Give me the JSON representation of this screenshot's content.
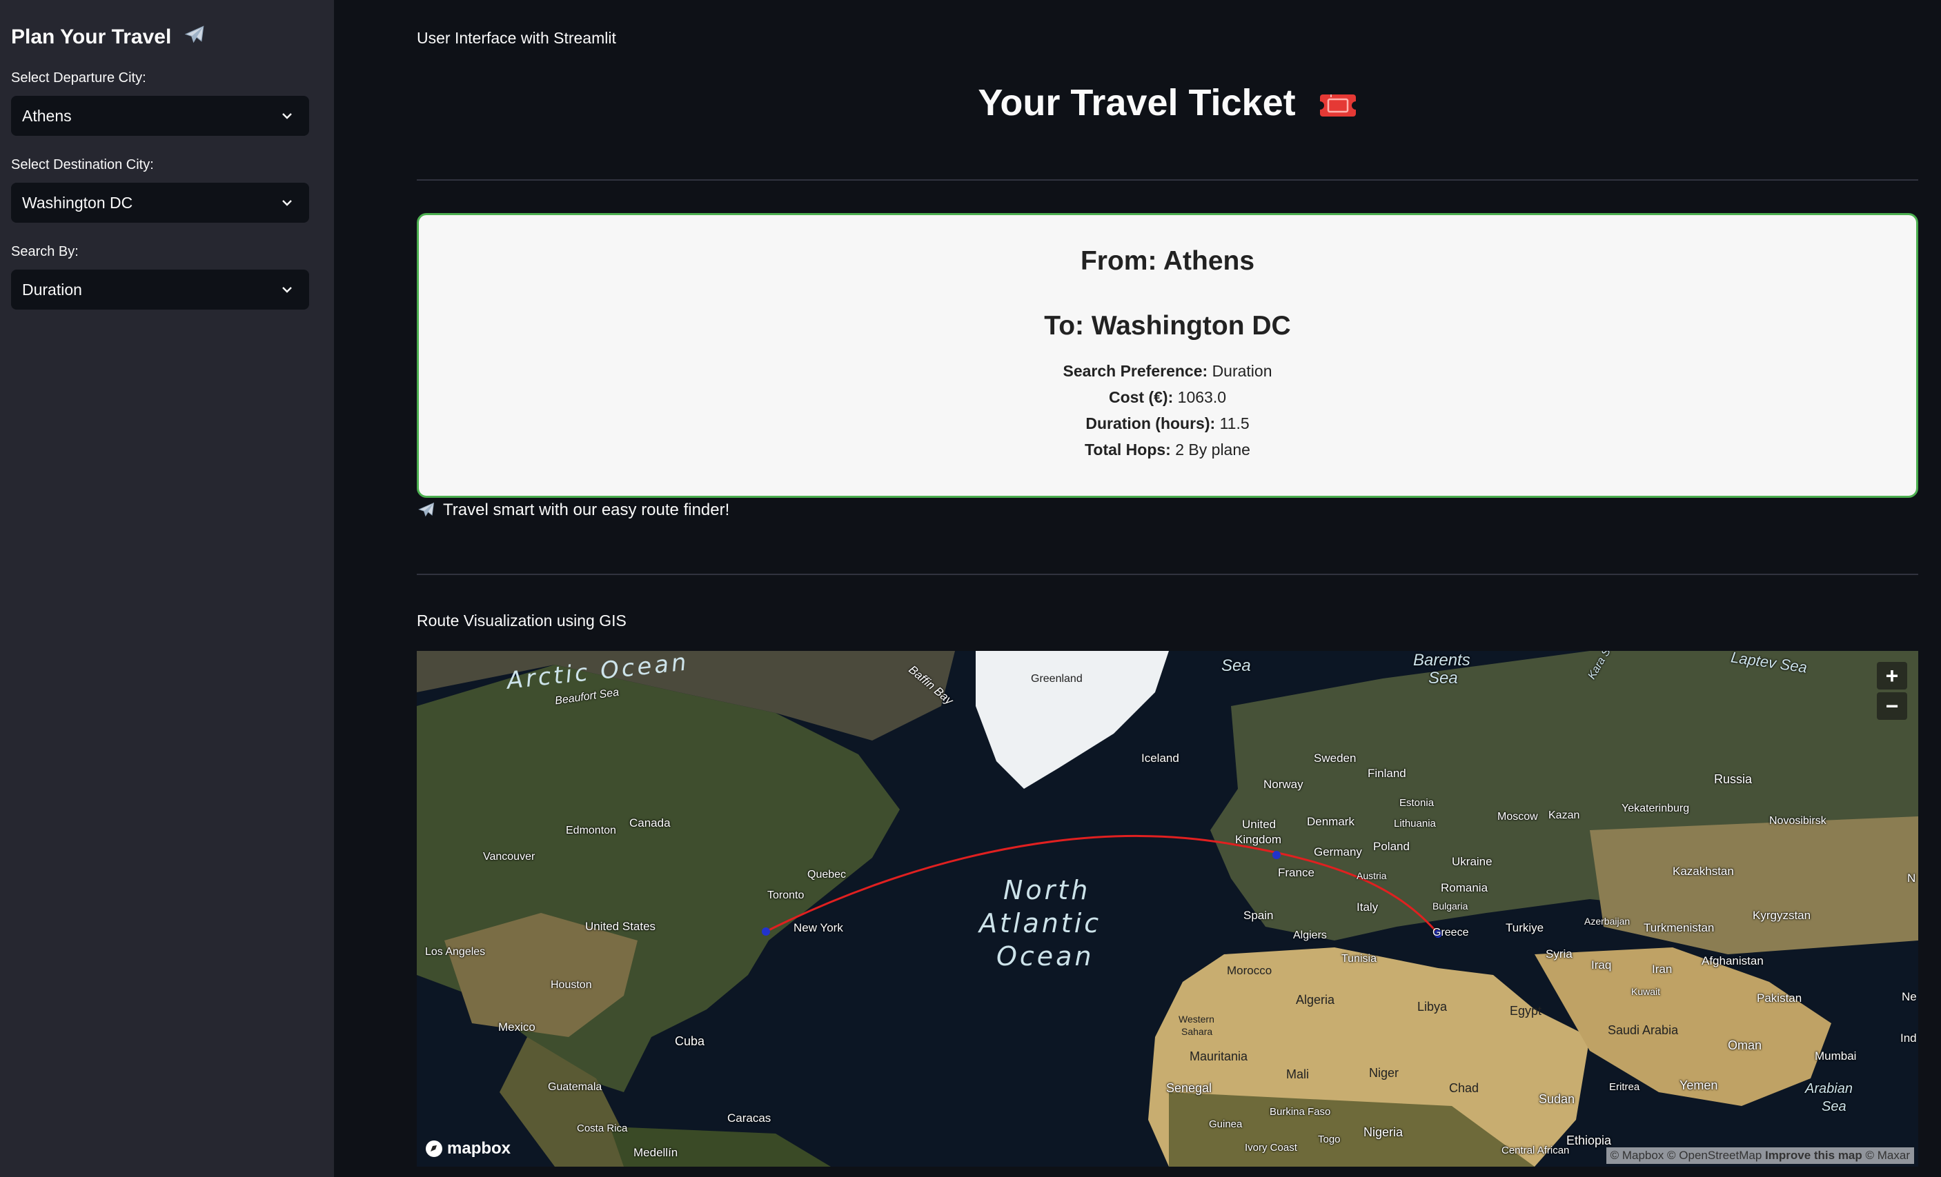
{
  "sidebar": {
    "title": "Plan Your Travel",
    "departure_label": "Select Departure City:",
    "departure_value": "Athens",
    "destination_label": "Select Destination City:",
    "destination_value": "Washington DC",
    "search_label": "Search By:",
    "search_value": "Duration"
  },
  "main": {
    "caption": "User Interface with Streamlit",
    "title": "Your Travel Ticket",
    "ticket": {
      "from": "From: Athens",
      "to": "To: Washington DC",
      "pref_label": "Search Preference:",
      "pref_value": "Duration",
      "cost_label": "Cost (€):",
      "cost_value": "1063.0",
      "duration_label": "Duration (hours):",
      "duration_value": "11.5",
      "hops_label": "Total Hops:",
      "hops_value": "2 By plane"
    },
    "tagline": "Travel smart with our easy route finder!",
    "viz_label": "Route Visualization using GIS"
  },
  "map": {
    "zoom_in": "+",
    "zoom_out": "−",
    "logo": "mapbox",
    "attribution_1": "© Mapbox © OpenStreetMap ",
    "attribution_2": "Improve this map",
    "attribution_3": " © Maxar",
    "ocean_arctic": "Arctic Ocean",
    "ocean_atlantic_1": "North",
    "ocean_atlantic_2": "Atlantic",
    "ocean_atlantic_3": "Ocean",
    "labels": {
      "beaufort": "Beaufort Sea",
      "baffin": "Baffin Bay",
      "greenland": "Greenland",
      "sea": "Sea",
      "barents_1": "Barents",
      "barents_2": "Sea",
      "kara": "Kara S",
      "laptev": "Laptev Sea",
      "iceland": "Iceland",
      "sweden": "Sweden",
      "finland": "Finland",
      "norway": "Norway",
      "estonia": "Estonia",
      "russia": "Russia",
      "denmark": "Denmark",
      "lithuania": "Lithuania",
      "moscow": "Moscow",
      "kazan": "Kazan",
      "yekaterinburg": "Yekaterinburg",
      "novosibirsk": "Novosibirsk",
      "edmonton": "Edmonton",
      "canada": "Canada",
      "uk_1": "United",
      "uk_2": "Kingdom",
      "germany": "Germany",
      "poland": "Poland",
      "ukraine": "Ukraine",
      "vancouver": "Vancouver",
      "quebec": "Quebec",
      "france": "France",
      "austria": "Austria",
      "kazakhstan": "Kazakhstan",
      "toronto": "Toronto",
      "romania": "Romania",
      "bulgaria": "Bulgaria",
      "united_states": "United States",
      "new_york": "New York",
      "spain": "Spain",
      "italy": "Italy",
      "kyrgyzstan": "Kyrgyzstan",
      "turkiye": "Turkiye",
      "azerbaijan": "Azerbaijan",
      "turkmenistan": "Turkmenistan",
      "greece": "Greece",
      "algiers": "Algiers",
      "los_angeles": "Los Angeles",
      "syria": "Syria",
      "tunisia": "Tunisia",
      "afghanistan": "Afghanistan",
      "iraq": "Iraq",
      "iran": "Iran",
      "morocco": "Morocco",
      "houston": "Houston",
      "kuwait": "Kuwait",
      "algeria": "Algeria",
      "libya": "Libya",
      "egypt": "Egypt",
      "pakistan": "Pakistan",
      "mexico": "Mexico",
      "western_sahara_1": "Western",
      "western_sahara_2": "Sahara",
      "saudi": "Saudi Arabia",
      "oman": "Oman",
      "cuba": "Cuba",
      "mauritania": "Mauritania",
      "mali": "Mali",
      "niger": "Niger",
      "mumbai": "Mumbai",
      "yemen": "Yemen",
      "chad": "Chad",
      "eritrea": "Eritrea",
      "arabian_1": "Arabian",
      "arabian_2": "Sea",
      "guatemala": "Guatemala",
      "senegal": "Senegal",
      "sudan": "Sudan",
      "burkina": "Burkina Faso",
      "caracas": "Caracas",
      "guinea": "Guinea",
      "nigeria": "Nigeria",
      "costa_rica": "Costa Rica",
      "togo": "Togo",
      "ethiopia": "Ethiopia",
      "medellin": "Medellín",
      "ivory": "Ivory Coast",
      "car": "Central African",
      "ind": "Ind",
      "n": "N",
      "ne": "Ne"
    }
  },
  "colors": {
    "route": "#e02020",
    "card_border": "#4caf50",
    "sidebar_bg": "#262730",
    "main_bg": "#0e1117"
  }
}
